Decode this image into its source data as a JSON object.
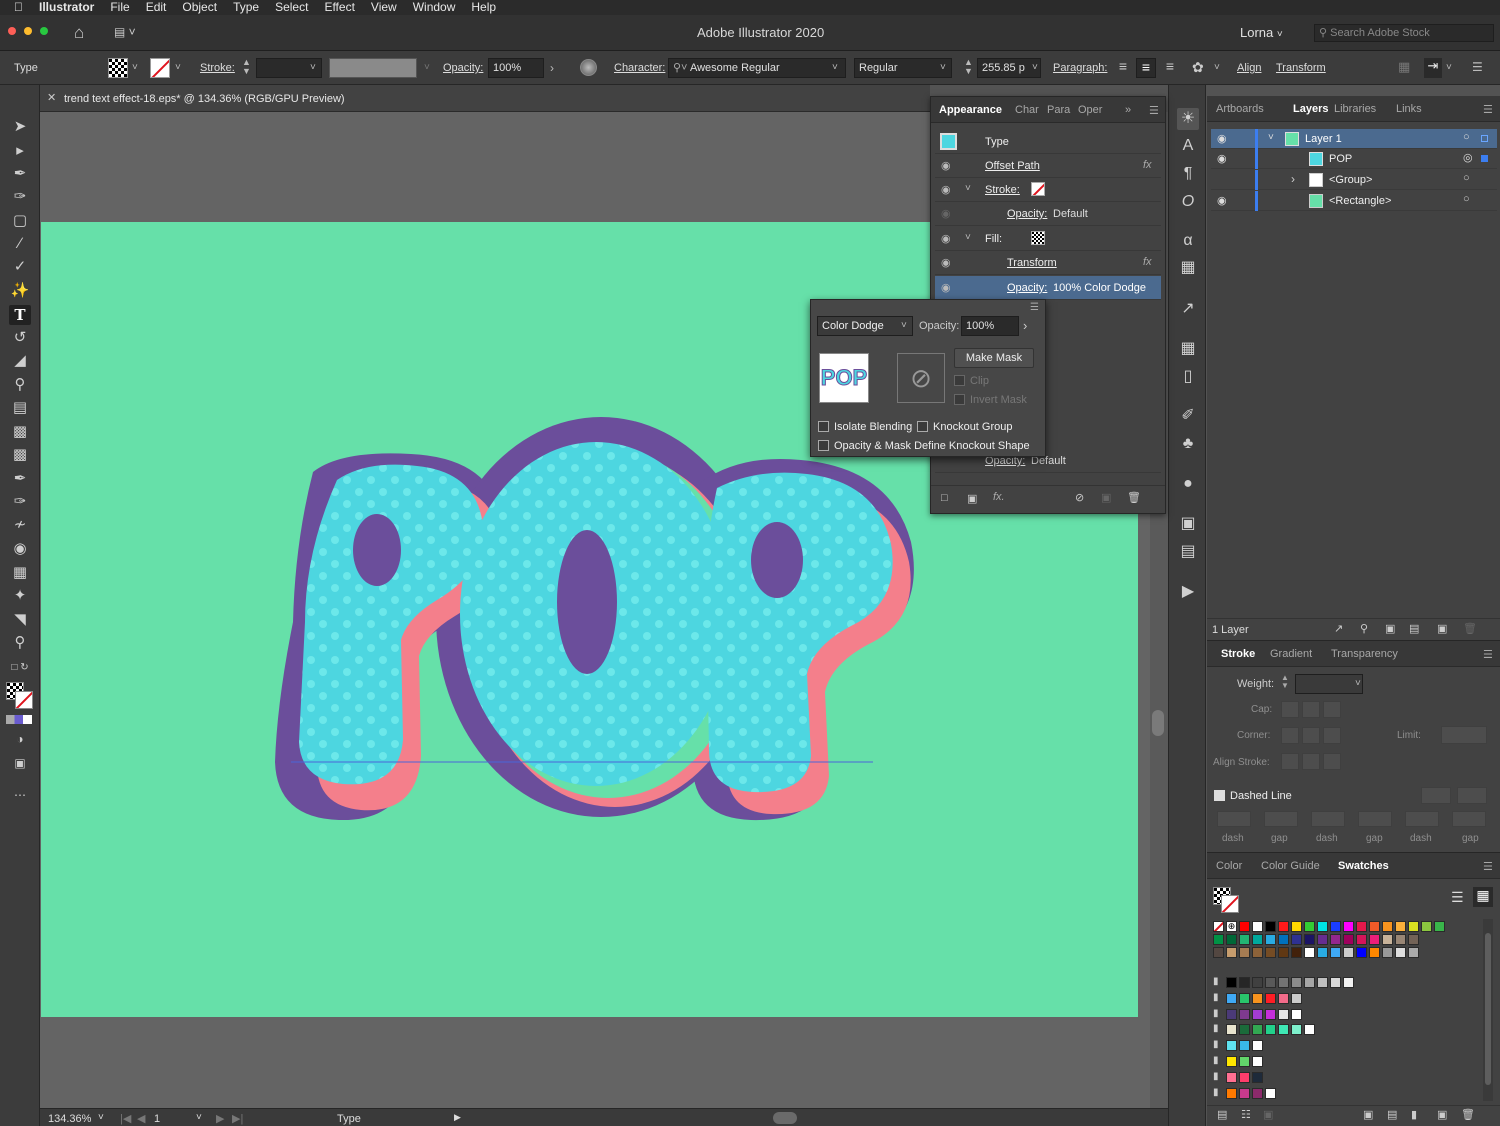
{
  "menubar": {
    "app": "Illustrator",
    "items": [
      "File",
      "Edit",
      "Object",
      "Type",
      "Select",
      "Effect",
      "View",
      "Window",
      "Help"
    ]
  },
  "titlebar": {
    "title": "Adobe Illustrator 2020",
    "user": "Lorna",
    "search_placeholder": "Search Adobe Stock"
  },
  "control": {
    "type_label": "Type",
    "stroke_label": "Stroke:",
    "opacity_label": "Opacity:",
    "opacity_value": "100%",
    "character_label": "Character:",
    "font": "Awesome Regular",
    "style": "Regular",
    "size": "255.85 p",
    "paragraph_label": "Paragraph:",
    "align_label": "Align",
    "transform_label": "Transform"
  },
  "document": {
    "tab_title": "trend text effect-18.eps* @ 134.36% (RGB/GPU Preview)",
    "artwork_text": "POP"
  },
  "status": {
    "zoom": "134.36%",
    "artboard": "1",
    "tool": "Type"
  },
  "appearance": {
    "tabs": [
      "Appearance",
      "Char",
      "Para",
      "Oper"
    ],
    "rows": [
      {
        "label": "Type"
      },
      {
        "label": "Offset Path"
      },
      {
        "label": "Stroke:"
      },
      {
        "label": "Opacity:",
        "value": "Default"
      },
      {
        "label": "Fill:"
      },
      {
        "label": "Transform"
      },
      {
        "label": "Opacity:",
        "value": "100% Color Dodge"
      }
    ],
    "bottom_opacity_label": "Opacity:",
    "bottom_opacity_value": "Default"
  },
  "transparency_popup": {
    "blend_mode": "Color Dodge",
    "opacity_label": "Opacity:",
    "opacity_value": "100%",
    "make_mask": "Make Mask",
    "clip": "Clip",
    "invert_mask": "Invert Mask",
    "isolate": "Isolate Blending",
    "knockout": "Knockout Group",
    "opacity_mask": "Opacity & Mask Define Knockout Shape",
    "thumb_text": "POP"
  },
  "layers_panel": {
    "tabs": [
      "Artboards",
      "Layers",
      "Libraries",
      "Links"
    ],
    "rows": [
      "Layer 1",
      "POP",
      "<Group>",
      "<Rectangle>"
    ],
    "count": "1 Layer"
  },
  "stroke_panel": {
    "tabs": [
      "Stroke",
      "Gradient",
      "Transparency"
    ],
    "weight": "Weight:",
    "cap": "Cap:",
    "corner": "Corner:",
    "limit": "Limit:",
    "align_stroke": "Align Stroke:",
    "dashed": "Dashed Line",
    "dash_labels": [
      "dash",
      "gap",
      "dash",
      "gap",
      "dash",
      "gap"
    ]
  },
  "swatch_panel": {
    "tabs": [
      "Color",
      "Color Guide",
      "Swatches"
    ],
    "row1": [
      "#ff0000",
      "#ffffff",
      "#000000",
      "#ff1a1a",
      "#ffd800",
      "#33cc33",
      "#00e5e5",
      "#1a3dff",
      "#ff00ff",
      "#e6194b",
      "#f05a28",
      "#f7931e",
      "#fbb03b",
      "#d9e021",
      "#8cc63f",
      "#39b54a"
    ],
    "row2": [
      "#009245",
      "#006837",
      "#22b573",
      "#00a99d",
      "#29abe2",
      "#0071bc",
      "#2e3192",
      "#1b1464",
      "#662d91",
      "#93278f",
      "#9e005d",
      "#d4145a",
      "#ed1e79",
      "#c7b299",
      "#998675",
      "#736357"
    ],
    "row3": [
      "#534741",
      "#c69c6d",
      "#a67c52",
      "#8c6239",
      "#754c24",
      "#603813",
      "#42210b",
      "#ffffff",
      "#29abe2",
      "#3fa9f5",
      "#cccccc",
      "#0000ff",
      "#ff8800",
      "#999999",
      "#dddddd",
      "#aaaaaa"
    ],
    "group1": [
      "#000000",
      "#262626",
      "#404040",
      "#595959",
      "#737373",
      "#8c8c8c",
      "#a6a6a6",
      "#bfbfbf",
      "#d9d9d9",
      "#f2f2f2"
    ],
    "group2": [
      "#3fa9f5",
      "#29c66b",
      "#f7931e",
      "#ff1d25",
      "#f26b8a",
      "#cccccc"
    ],
    "group3": [
      "#4b3a78",
      "#7f3a8f",
      "#a23cd1",
      "#c52fd9",
      "#e6e6e6",
      "#ffffff"
    ],
    "group4": [
      "#e9e4cf",
      "#1b6b3a",
      "#32a852",
      "#22d18b",
      "#3fe8b5",
      "#7ef0cc",
      "#ffffff"
    ],
    "group5": [
      "#5fe2f0",
      "#39b8e8",
      "#ffffff"
    ],
    "group6": [
      "#ffe600",
      "#62d66a",
      "#ffffff"
    ],
    "group7": [
      "#ff6f91",
      "#ff3d6b",
      "#1e2a3a"
    ],
    "group8": [
      "#ff7a00",
      "#c83a8c",
      "#8c2a6b",
      "#ffffff"
    ]
  },
  "colors": {
    "artboard": "#66e0a9",
    "pop_fill": "#4dd6e0",
    "pop_outline": "#6b4e9b",
    "pop_shadow": "#f47f8b",
    "highlight": "#4b6a8f"
  }
}
